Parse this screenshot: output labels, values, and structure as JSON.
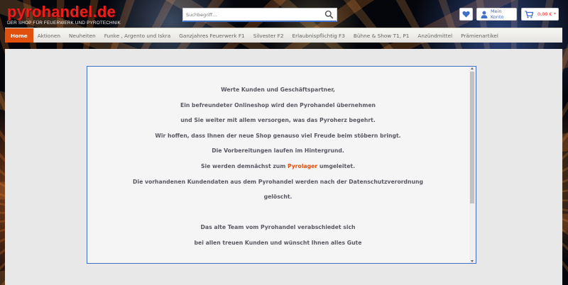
{
  "brand": {
    "name": "pyrohandel.de",
    "tagline": "DER SHOP FÜR FEUERWERK UND PYROTECHNIK"
  },
  "search": {
    "placeholder": "Suchbegriff..."
  },
  "header": {
    "wishlist_icon": "heart-icon",
    "account_label": "Mein Konto",
    "cart_label": "0,00 € *"
  },
  "nav": {
    "items": [
      {
        "label": "Home",
        "active": true
      },
      {
        "label": "Aktionen"
      },
      {
        "label": "Neuheiten"
      },
      {
        "label": "Funke , Argento und Iskra"
      },
      {
        "label": "Ganzjahres Feuerwerk F1"
      },
      {
        "label": "Silvester F2"
      },
      {
        "label": "Erlaubnispflichtig F3"
      },
      {
        "label": "Bühne & Show T1, P1"
      },
      {
        "label": "Anzündmittel"
      },
      {
        "label": "Prämienartikel"
      }
    ]
  },
  "message": {
    "lines": [
      "Werte Kunden und Geschäftspartner,",
      "Ein befreundeter Onlineshop wird den Pyrohandel übernehmen",
      "und Sie weiter mit allem versorgen, was das Pyroherz begehrt.",
      "Wir hoffen, dass Ihnen der neue Shop genauso viel Freude beim stöbern bringt.",
      "Die Vorbereitungen laufen im Hintergrund."
    ],
    "redirect_prefix": "Sie werden demnächst zum ",
    "redirect_link": "Pyrolager",
    "redirect_suffix": " umgeleitet.",
    "lines2": [
      "Die vorhandenen Kundendaten aus dem Pyrohandel werden nach der Datenschutzverordnung",
      "gelöscht.",
      "",
      "Das alte Team vom Pyrohandel verabschiedet sich",
      "bei allen treuen Kunden und wünscht Ihnen alles Gute"
    ]
  },
  "colors": {
    "accent": "#e2500e",
    "brand_red": "#e8201c",
    "link_blue": "#3f6fc6"
  }
}
